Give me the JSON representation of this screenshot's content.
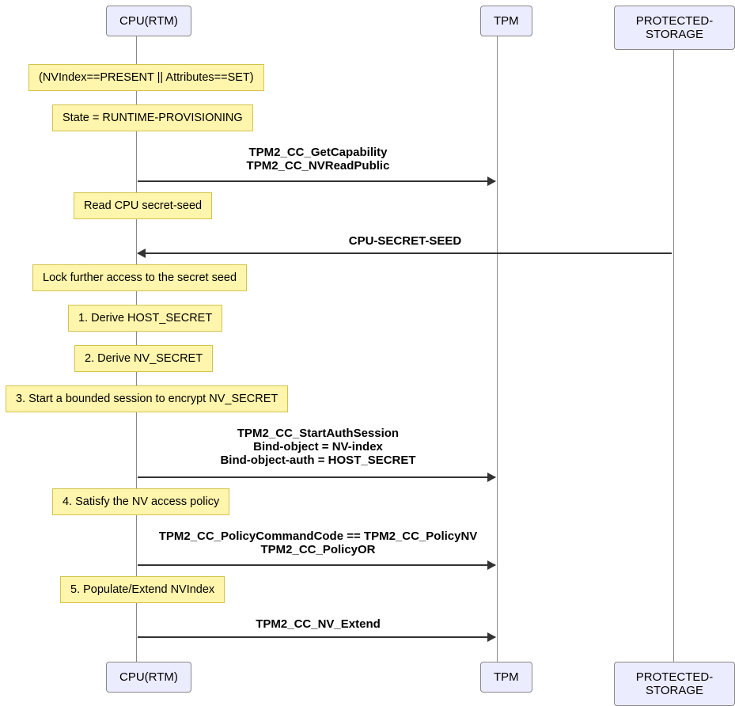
{
  "actors": {
    "cpu": "CPU(RTM)",
    "tpm": "TPM",
    "storage": "PROTECTED-STORAGE"
  },
  "notes": {
    "n1": "(NVIndex==PRESENT || Attributes==SET)",
    "n2": "State = RUNTIME-PROVISIONING",
    "n3": "Read CPU secret-seed",
    "n4": "Lock further access to the secret seed",
    "n5": "1. Derive HOST_SECRET",
    "n6": "2. Derive NV_SECRET",
    "n7": "3. Start a bounded session to encrypt NV_SECRET",
    "n8": "4. Satisfy the NV access policy",
    "n9": "5. Populate/Extend NVIndex"
  },
  "messages": {
    "m1a": "TPM2_CC_GetCapability",
    "m1b": "TPM2_CC_NVReadPublic",
    "m2": "CPU-SECRET-SEED",
    "m3a": "TPM2_CC_StartAuthSession",
    "m3b": "Bind-object = NV-index",
    "m3c": "Bind-object-auth = HOST_SECRET",
    "m4a": "TPM2_CC_PolicyCommandCode == TPM2_CC_PolicyNV",
    "m4b": "TPM2_CC_PolicyOR",
    "m5": "TPM2_CC_NV_Extend"
  }
}
